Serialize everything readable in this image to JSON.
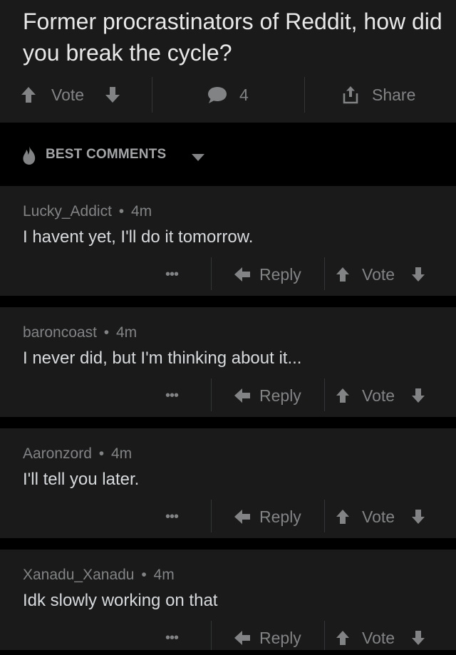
{
  "post": {
    "title": "Former procrastinators of Reddit, how did you break the cycle?",
    "vote_label": "Vote",
    "comment_count": "4",
    "share_label": "Share"
  },
  "sort": {
    "label": "BEST COMMENTS"
  },
  "comments": [
    {
      "author": "Lucky_Addict",
      "age": "4m",
      "body": "I havent yet, I'll do it tomorrow.",
      "more_label": "•••",
      "reply_label": "Reply",
      "vote_label": "Vote"
    },
    {
      "author": "baroncoast",
      "age": "4m",
      "body": "I never did, but I'm thinking about it...",
      "more_label": "•••",
      "reply_label": "Reply",
      "vote_label": "Vote"
    },
    {
      "author": "Aaronzord",
      "age": "4m",
      "body": "I'll tell you later.",
      "more_label": "•••",
      "reply_label": "Reply",
      "vote_label": "Vote"
    },
    {
      "author": "Xanadu_Xanadu",
      "age": "4m",
      "body": "Idk slowly working on that",
      "more_label": "•••",
      "reply_label": "Reply",
      "vote_label": "Vote"
    }
  ],
  "meta_separator": "•",
  "colors": {
    "background": "#000000",
    "card": "#1a1a1b",
    "title_text": "#e8e8e8",
    "body_text": "#d7dadc",
    "muted_text": "#818384"
  }
}
